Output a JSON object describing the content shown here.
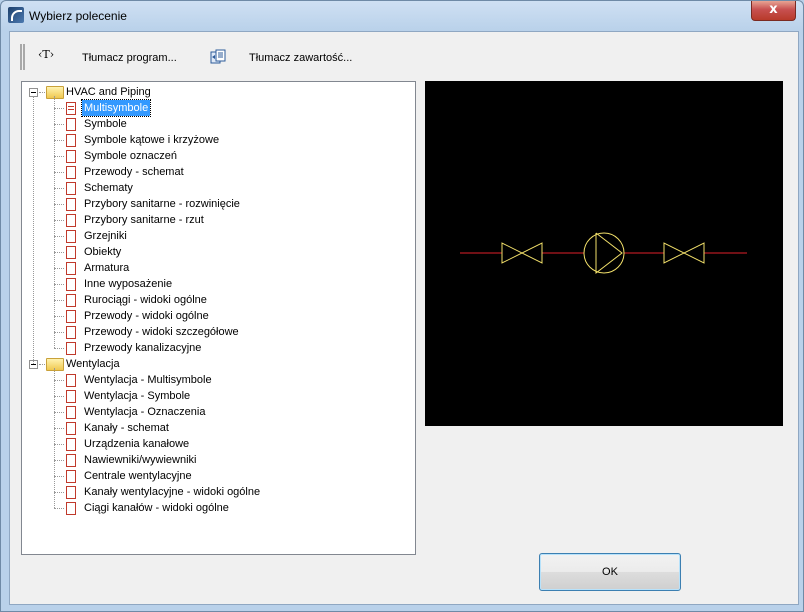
{
  "window": {
    "title": "Wybierz polecenie",
    "close_symbol": "x"
  },
  "toolbar": {
    "translator_icon_text": "‹T›",
    "translate_program": "Tłumacz program...",
    "translate_content": "Tłumacz zawartość..."
  },
  "tree": {
    "groups": [
      {
        "label": "HVAC and Piping",
        "items": [
          "Multisymbole",
          "Symbole",
          "Symbole kątowe i krzyżowe",
          "Symbole oznaczeń",
          "Przewody - schemat",
          "Schematy",
          "Przybory sanitarne - rozwinięcie",
          "Przybory sanitarne - rzut",
          "Grzejniki",
          "Obiekty",
          "Armatura",
          "Inne wyposażenie",
          "Rurociągi - widoki ogólne",
          "Przewody - widoki ogólne",
          "Przewody - widoki szczegółowe",
          "Przewody kanalizacyjne"
        ]
      },
      {
        "label": "Wentylacja",
        "items": [
          "Wentylacja - Multisymbole",
          "Wentylacja - Symbole",
          "Wentylacja - Oznaczenia",
          "Kanały - schemat",
          "Urządzenia kanałowe",
          "Nawiewniki/wywiewniki",
          "Centrale wentylacyjne",
          "Kanały wentylacyjne - widoki ogólne",
          "Ciągi kanałów - widoki ogólne"
        ]
      }
    ],
    "selected_item": "Multisymbole"
  },
  "preview": {
    "line_color": "#e0202a",
    "symbol_color": "#f2e06a",
    "background": "#000000"
  },
  "buttons": {
    "ok_label": "OK"
  }
}
